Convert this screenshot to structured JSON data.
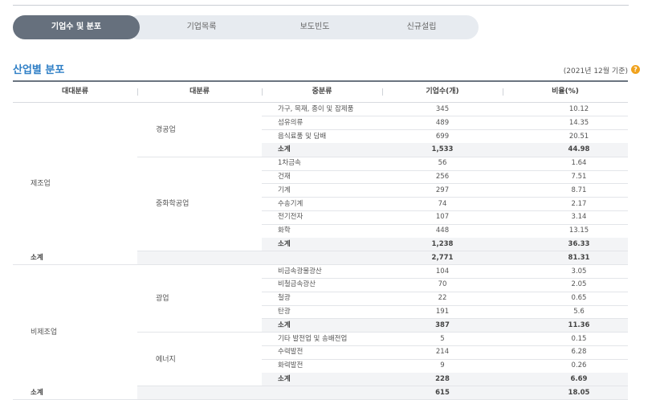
{
  "tabs": [
    "기업수 및 분포",
    "기업목록",
    "보도빈도",
    "신규설립"
  ],
  "section_title": "산업별 분포",
  "basis": "(2021년 12월 기준)",
  "help_glyph": "?",
  "table": {
    "headers": [
      "대대분류",
      "대분류",
      "중분류",
      "기업수(개)",
      "비율(%)"
    ],
    "level1": [
      "제조업",
      "비제조업"
    ],
    "level2": [
      "경공업",
      "중화학공업",
      "광업",
      "에너지"
    ],
    "rows": [
      {
        "name": "가구, 목재, 종이 및 잡제품",
        "count": "345",
        "ratio": "10.12"
      },
      {
        "name": "섬유의류",
        "count": "489",
        "ratio": "14.35"
      },
      {
        "name": "음식료품 및 담배",
        "count": "699",
        "ratio": "20.51"
      },
      {
        "name": "소계",
        "count": "1,533",
        "ratio": "44.98"
      },
      {
        "name": "1차금속",
        "count": "56",
        "ratio": "1.64"
      },
      {
        "name": "건재",
        "count": "256",
        "ratio": "7.51"
      },
      {
        "name": "기계",
        "count": "297",
        "ratio": "8.71"
      },
      {
        "name": "수송기계",
        "count": "74",
        "ratio": "2.17"
      },
      {
        "name": "전기전자",
        "count": "107",
        "ratio": "3.14"
      },
      {
        "name": "화학",
        "count": "448",
        "ratio": "13.15"
      },
      {
        "name": "소계",
        "count": "1,238",
        "ratio": "36.33"
      },
      {
        "name": "소계",
        "count": "2,771",
        "ratio": "81.31"
      },
      {
        "name": "비금속광물광산",
        "count": "104",
        "ratio": "3.05"
      },
      {
        "name": "비철금속광산",
        "count": "70",
        "ratio": "2.05"
      },
      {
        "name": "철광",
        "count": "22",
        "ratio": "0.65"
      },
      {
        "name": "탄광",
        "count": "191",
        "ratio": "5.6"
      },
      {
        "name": "소계",
        "count": "387",
        "ratio": "11.36"
      },
      {
        "name": "기타 발전업 및 송배전업",
        "count": "5",
        "ratio": "0.15"
      },
      {
        "name": "수력발전",
        "count": "214",
        "ratio": "6.28"
      },
      {
        "name": "화력발전",
        "count": "9",
        "ratio": "0.26"
      },
      {
        "name": "소계",
        "count": "228",
        "ratio": "6.69"
      },
      {
        "name": "소계",
        "count": "615",
        "ratio": "18.05"
      }
    ]
  }
}
